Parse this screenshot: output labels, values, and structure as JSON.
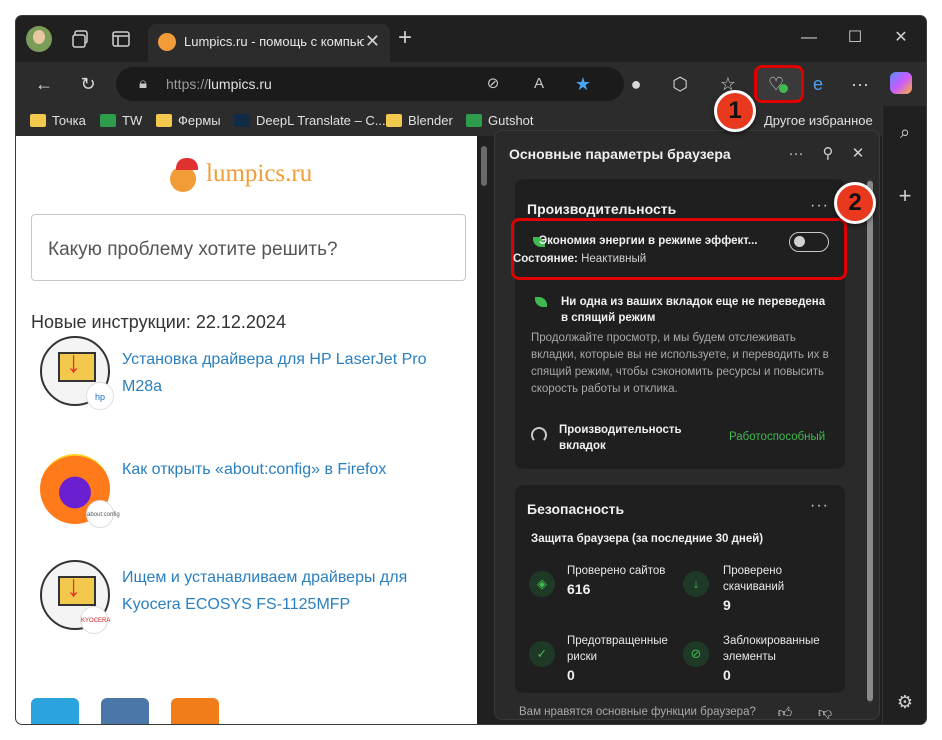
{
  "tab": {
    "title": "Lumpics.ru - помощь с компьюте",
    "close": "✕"
  },
  "window_controls": {
    "minimize": "—",
    "maximize": "☐",
    "close": "✕"
  },
  "new_tab": "+",
  "address_bar": {
    "protocol": "https://",
    "host": "lumpics.ru"
  },
  "favorites": {
    "items": [
      {
        "label": "Точка",
        "icon": "folder-icon"
      },
      {
        "label": "TW",
        "icon": "tw-icon"
      },
      {
        "label": "Фермы",
        "icon": "folder-icon"
      },
      {
        "label": "DeepL Translate – C...",
        "icon": "deepl-icon"
      },
      {
        "label": "Blender",
        "icon": "folder-icon"
      },
      {
        "label": "Gutshot",
        "icon": "tw-icon"
      }
    ],
    "other": "Другое избранное"
  },
  "page": {
    "logo": "lumpics.ru",
    "search_placeholder": "Какую проблему хотите решить?",
    "news_heading": "Новые инструкции: 22.12.2024",
    "articles": [
      {
        "title": "Установка драйвера для HP LaserJet Pro M28a",
        "badge": "hp"
      },
      {
        "title": "Как открыть «about:config» в Firefox",
        "badge": "about:config"
      },
      {
        "title": "Ищем и устанавливаем драйверы для Kyocera ECOSYS FS-1125MFP",
        "badge": "KYOCERA"
      }
    ],
    "social_colors": [
      "#2aa3df",
      "#4a76a8",
      "#f07d1a"
    ]
  },
  "panel": {
    "title": "Основные параметры браузера",
    "performance": {
      "heading": "Производительность",
      "more": "···",
      "efficiency_label": "Экономия энергии в режиме эффект...",
      "state_label": "Состояние:",
      "state_value": "Неактивный",
      "sleep_title": "Ни одна из ваших вкладок еще не переведена в спящий режим",
      "sleep_desc": "Продолжайте просмотр, и мы будем отслеживать вкладки, которые вы не используете, и переводить их в спящий режим, чтобы сэкономить ресурсы и повысить скорость работы и отклика.",
      "tab_perf_label": "Производительность вкладок",
      "tab_perf_value": "Работоспособный"
    },
    "security": {
      "heading": "Безопасность",
      "more": "···",
      "subtitle": "Защита браузера (за последние 30 дней)",
      "stats": [
        {
          "label": "Проверено сайтов",
          "value": "616",
          "icon": "shield-icon"
        },
        {
          "label": "Проверено скачиваний",
          "value": "9",
          "icon": "download-icon"
        },
        {
          "label": "Предотвращенные риски",
          "value": "0",
          "icon": "shield-check-icon"
        },
        {
          "label": "Заблокированные элементы",
          "value": "0",
          "icon": "block-icon"
        }
      ]
    },
    "feedback": "Вам нравятся основные функции браузера?"
  },
  "markers": [
    "1",
    "2"
  ],
  "colors": {
    "accent_green": "#3fb950",
    "highlight_red": "#e00000",
    "marker": "#e8391e"
  }
}
